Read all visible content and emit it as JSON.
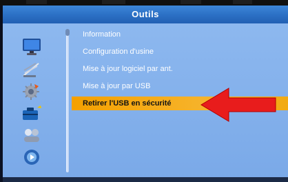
{
  "window": {
    "title": "Outils"
  },
  "sidebar": {
    "icons": [
      {
        "name": "monitor-icon"
      },
      {
        "name": "antenna-dish-icon"
      },
      {
        "name": "gear-icon"
      },
      {
        "name": "toolbox-icon",
        "active": true
      },
      {
        "name": "game-icon"
      },
      {
        "name": "media-icon"
      }
    ]
  },
  "menu": {
    "items": [
      {
        "label": "Information"
      },
      {
        "label": "Configuration d'usine"
      },
      {
        "label": "Mise à jour logiciel par ant."
      },
      {
        "label": "Mise à jour par USB"
      },
      {
        "label": "Retirer l'USB en sécurité",
        "selected": true
      }
    ]
  },
  "colors": {
    "title_bar": "#2b6fc4",
    "panel": "#7aa9e8",
    "highlight": "#f4a000",
    "arrow": "#e81c1c"
  }
}
